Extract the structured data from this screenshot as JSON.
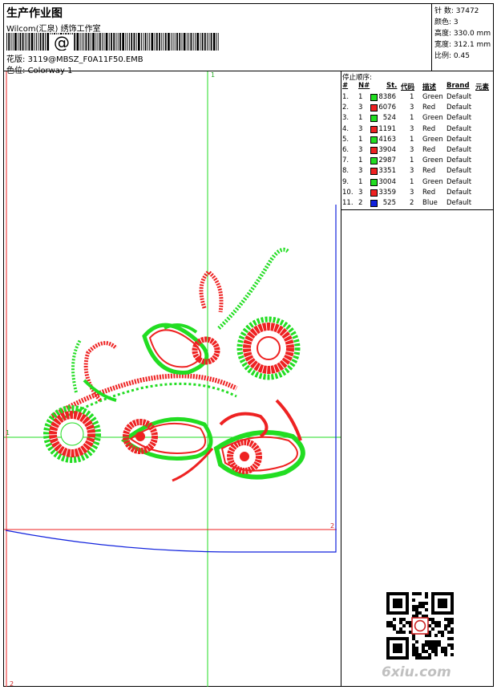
{
  "header": {
    "title": "生产作业图",
    "company": "Wilcom(汇泉) 绣饰工作室",
    "barcode_text": "@",
    "design_label": "花版:",
    "design_value": "3119@MBSZ_F0A11F50.EMB",
    "colorway_label": "色位:",
    "colorway_value": "Colorway 1"
  },
  "stats": [
    {
      "label": "针 数:",
      "value": "37472"
    },
    {
      "label": "颜色:",
      "value": "3"
    },
    {
      "label": "高度:",
      "value": "330.0 mm"
    },
    {
      "label": "宽度:",
      "value": "312.1 mm"
    },
    {
      "label": "比例:",
      "value": "0.45"
    }
  ],
  "stop_sequence": {
    "caption": "停止顺序:",
    "columns": [
      "#",
      "N#",
      "St.",
      "代码",
      "描述",
      "Brand",
      "元素"
    ],
    "rows": [
      {
        "n": "1.",
        "needle": "1",
        "color": "#22dd22",
        "stitches": "8386",
        "code": "1",
        "desc": "Green",
        "brand": "Default"
      },
      {
        "n": "2.",
        "needle": "3",
        "color": "#ee2222",
        "stitches": "6076",
        "code": "3",
        "desc": "Red",
        "brand": "Default"
      },
      {
        "n": "3.",
        "needle": "1",
        "color": "#22dd22",
        "stitches": "524",
        "code": "1",
        "desc": "Green",
        "brand": "Default"
      },
      {
        "n": "4.",
        "needle": "3",
        "color": "#ee2222",
        "stitches": "1191",
        "code": "3",
        "desc": "Red",
        "brand": "Default"
      },
      {
        "n": "5.",
        "needle": "1",
        "color": "#22dd22",
        "stitches": "4163",
        "code": "1",
        "desc": "Green",
        "brand": "Default"
      },
      {
        "n": "6.",
        "needle": "3",
        "color": "#ee2222",
        "stitches": "3904",
        "code": "3",
        "desc": "Red",
        "brand": "Default"
      },
      {
        "n": "7.",
        "needle": "1",
        "color": "#22dd22",
        "stitches": "2987",
        "code": "1",
        "desc": "Green",
        "brand": "Default"
      },
      {
        "n": "8.",
        "needle": "3",
        "color": "#ee2222",
        "stitches": "3351",
        "code": "3",
        "desc": "Red",
        "brand": "Default"
      },
      {
        "n": "9.",
        "needle": "1",
        "color": "#22dd22",
        "stitches": "3004",
        "code": "1",
        "desc": "Green",
        "brand": "Default"
      },
      {
        "n": "10.",
        "needle": "3",
        "color": "#ee2222",
        "stitches": "3359",
        "code": "3",
        "desc": "Red",
        "brand": "Default"
      },
      {
        "n": "11.",
        "needle": "2",
        "color": "#1122dd",
        "stitches": "525",
        "code": "2",
        "desc": "Blue",
        "brand": "Default"
      }
    ]
  },
  "canvas_marks": {
    "top": "1",
    "left": "1",
    "right_mid": "2",
    "bottom_left": "2"
  },
  "colors": {
    "green": "#22dd22",
    "red": "#ee2222",
    "blue": "#1122dd"
  },
  "watermark": {
    "site": "6xiu.com"
  }
}
